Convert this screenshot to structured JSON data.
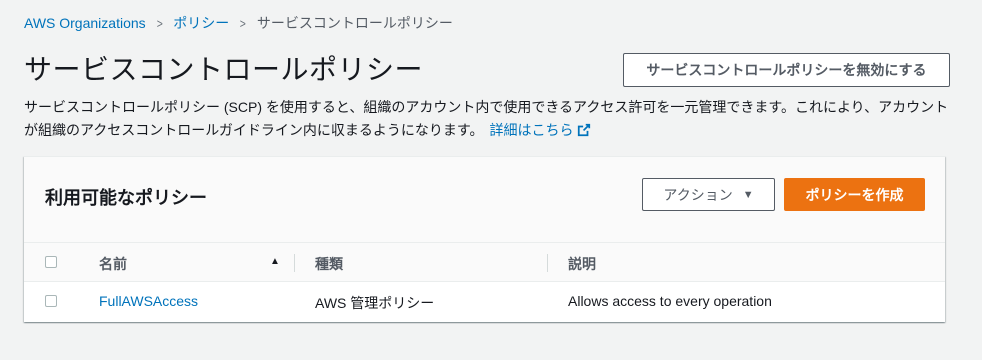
{
  "breadcrumb": {
    "items": [
      "AWS Organizations",
      "ポリシー",
      "サービスコントロールポリシー"
    ],
    "separator": ">"
  },
  "header": {
    "title": "サービスコントロールポリシー",
    "disable_button": "サービスコントロールポリシーを無効にする"
  },
  "description": {
    "text": "サービスコントロールポリシー (SCP) を使用すると、組織のアカウント内で使用できるアクセス許可を一元管理できます。これにより、アカウントが組織のアクセスコントロールガイドライン内に収まるようになります。",
    "link": "詳細はこちら"
  },
  "panel": {
    "title": "利用可能なポリシー",
    "actions_button": "アクション",
    "create_button": "ポリシーを作成"
  },
  "table": {
    "columns": [
      "名前",
      "種類",
      "説明"
    ],
    "rows": [
      {
        "name": "FullAWSAccess",
        "type": "AWS 管理ポリシー",
        "description": "Allows access to every operation"
      }
    ]
  },
  "icons": {
    "sort": "sort-ascending-icon",
    "external": "external-link-icon",
    "caret": "caret-down-icon"
  },
  "colors": {
    "link": "#0073bb",
    "primary": "#ec7211",
    "background": "#f2f3f3"
  }
}
